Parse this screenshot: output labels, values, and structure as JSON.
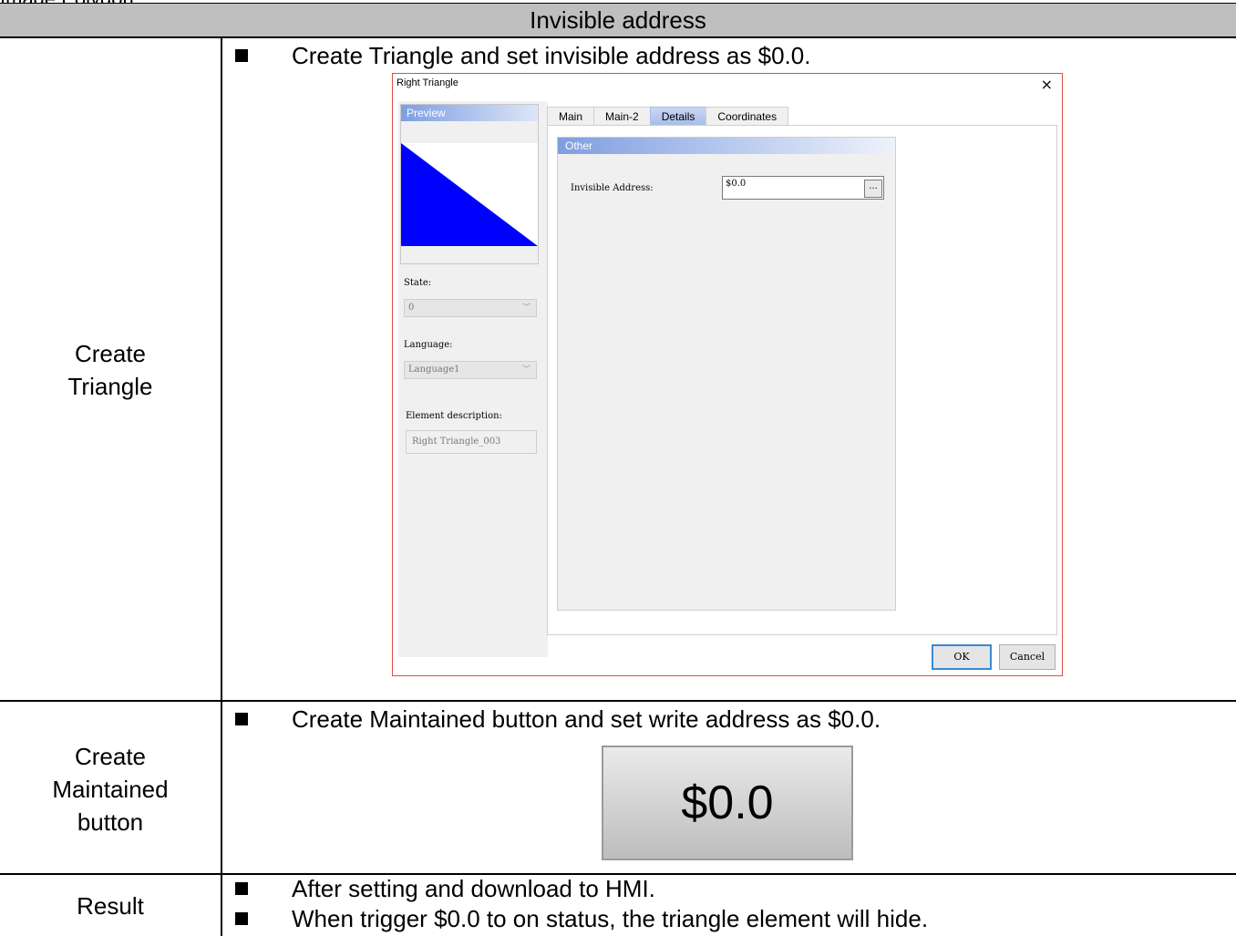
{
  "cut_heading": "Image Polygon",
  "header": {
    "title": "Invisible address"
  },
  "rows": [
    {
      "label_lines": [
        "Create",
        "Triangle"
      ],
      "bullets": [
        "Create Triangle and set invisible address as $0.0."
      ]
    },
    {
      "label_lines": [
        "Create",
        "Maintained",
        "button"
      ],
      "bullets": [
        "Create Maintained button and set write address as $0.0."
      ]
    },
    {
      "label_lines": [
        "Result"
      ],
      "bullets": [
        "After setting and download to HMI.",
        "When trigger $0.0 to on status, the triangle element will hide."
      ]
    }
  ],
  "dialog": {
    "title": "Right Triangle",
    "close_glyph": "×",
    "preview_label": "Preview",
    "state_label": "State:",
    "state_value": "0",
    "language_label": "Language:",
    "language_value": "Language1",
    "description_label": "Element description:",
    "description_value": "Right Triangle_003",
    "tabs": [
      "Main",
      "Main-2",
      "Details",
      "Coordinates"
    ],
    "active_tab": "Details",
    "group_label": "Other",
    "invisible_address_label": "Invisible Address:",
    "invisible_address_value": "$0.0",
    "browse_button": "...",
    "ok_label": "OK",
    "cancel_label": "Cancel",
    "triangle_color": "#0000ff"
  },
  "maintained_button": {
    "label": "$0.0"
  }
}
